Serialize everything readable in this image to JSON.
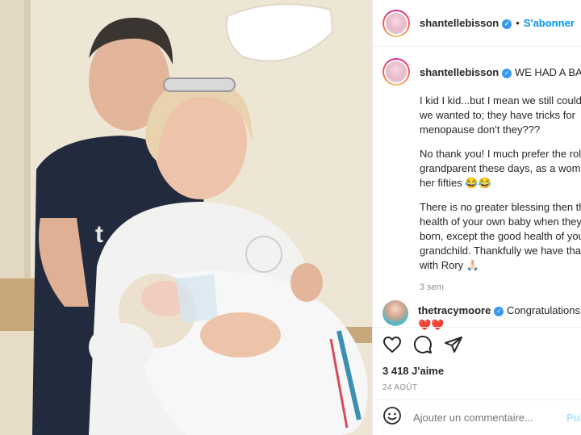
{
  "post": {
    "username": "shantellebisson",
    "follow_label": "S'abonner",
    "separator": "•",
    "caption": {
      "username": "shantellebisson",
      "headline": "WE HAD A BABY",
      "paragraphs": [
        [
          "I kid I kid...but I mean we still could if",
          "we wanted to; they have tricks for",
          "menopause don't they???"
        ],
        [
          "No thank you! I much prefer the role of",
          "grandparent these days, as a woman in",
          "her fifties 😂😂"
        ],
        [
          "There is no greater blessing then the",
          "health of your own baby when they are",
          "born, except the good health of your",
          "grandchild. Thankfully we have that",
          "with Rory 🙏🏻"
        ]
      ],
      "time": "3 sem"
    },
    "comment": {
      "username": "thetracymoore",
      "text": "Congratulations",
      "emoji": "❤️❤️"
    },
    "likes": "3 418 J'aime",
    "date": "24 AOÛT",
    "add_comment_placeholder": "Ajouter un commentaire...",
    "post_label": "Publier"
  },
  "icons": {
    "verified": "verified-badge-icon",
    "heart": "heart-icon",
    "comment": "comment-icon",
    "share": "share-icon",
    "emoji": "emoji-icon"
  },
  "colors": {
    "follow": "#0095f6",
    "verified": "#3897f0",
    "secondary_text": "#8e8e8e"
  }
}
